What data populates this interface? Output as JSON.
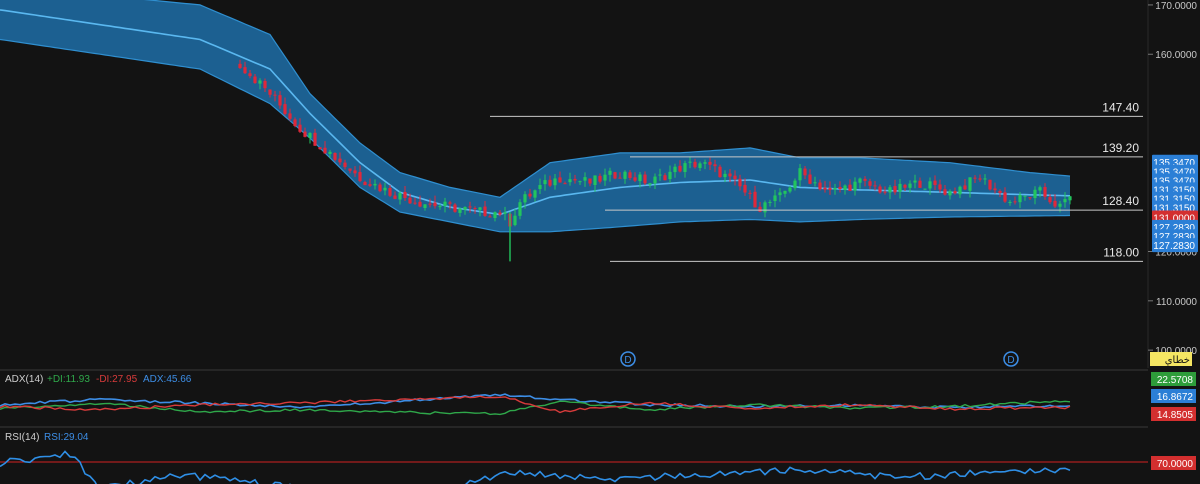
{
  "colors": {
    "background": "#131313",
    "band_fill": "#1e6fa8",
    "band_edge": "#2f8fd0",
    "mid_line": "#5ab8f0",
    "candle_up": "#22c55e",
    "candle_down": "#e0283a",
    "level_line": "#c8c8c8",
    "badge_blue": "#2b7fd6",
    "badge_red": "#d32f2f",
    "badge_green": "#2e9d3a",
    "badge_yellow": "#f5e663",
    "adx_line": "#3d8ee6",
    "plus_di_line": "#2fa84a",
    "minus_di_line": "#d83b3b",
    "rsi_line": "#2f8fe6",
    "rsi_level": "#d02020"
  },
  "price_axis": {
    "ticks": [
      "170.0000",
      "160.0000",
      "120.0000",
      "110.0000",
      "100.0000"
    ],
    "tick_values": [
      170,
      160,
      120,
      110,
      100
    ]
  },
  "level_labels": {
    "l147": "147.40",
    "l139": "139.20",
    "l128": "128.40",
    "l118": "118.00"
  },
  "price_badges": [
    {
      "text": "135.3470",
      "value": 138.2,
      "kind": "blue"
    },
    {
      "text": "135.3470",
      "value": 136.2,
      "kind": "blue"
    },
    {
      "text": "135.3470",
      "value": 134.4,
      "kind": "blue"
    },
    {
      "text": "131.3150",
      "value": 132.6,
      "kind": "blue"
    },
    {
      "text": "131.3150",
      "value": 130.7,
      "kind": "blue"
    },
    {
      "text": "131.3150",
      "value": 128.9,
      "kind": "blue"
    },
    {
      "text": "131.0000",
      "value": 126.9,
      "kind": "red"
    },
    {
      "text": "127.2830",
      "value": 125.0,
      "kind": "blue"
    },
    {
      "text": "127.2830",
      "value": 123.1,
      "kind": "blue"
    },
    {
      "text": "127.2830",
      "value": 121.3,
      "kind": "blue"
    }
  ],
  "event_markers": [
    "D",
    "D"
  ],
  "yellow_badge": "خطاي",
  "adx_panel": {
    "label": "ADX(14)",
    "plus_di": "+DI:11.93",
    "minus_di": "-DI:27.95",
    "adx": "ADX:45.66",
    "badges": [
      "22.5708",
      "16.8672",
      "14.8505"
    ]
  },
  "rsi_panel": {
    "label": "RSI(14)",
    "rsi": "RSI:29.04",
    "badge": "70.0000"
  },
  "chart_data": {
    "type": "candlestick",
    "title": "",
    "xlabel": "",
    "ylabel": "",
    "ylim": [
      98,
      171
    ],
    "indicators": [
      "Bollinger Bands",
      "ADX(14)",
      "RSI(14)"
    ],
    "levels": [
      147.4,
      139.2,
      128.4,
      118.0
    ],
    "price_path": [
      [
        0,
        172
      ],
      [
        6,
        171
      ],
      [
        12,
        168
      ],
      [
        18,
        165
      ],
      [
        24,
        163
      ],
      [
        30,
        163
      ],
      [
        36,
        162
      ],
      [
        42,
        160
      ],
      [
        48,
        158
      ],
      [
        54,
        152
      ],
      [
        60,
        145
      ],
      [
        66,
        140
      ],
      [
        72,
        135
      ],
      [
        78,
        132
      ],
      [
        84,
        130
      ],
      [
        90,
        129
      ],
      [
        96,
        128
      ],
      [
        100,
        128
      ],
      [
        102,
        126
      ],
      [
        104,
        130
      ],
      [
        108,
        133
      ],
      [
        112,
        135
      ],
      [
        118,
        134
      ],
      [
        124,
        136
      ],
      [
        130,
        134
      ],
      [
        136,
        137
      ],
      [
        140,
        138
      ],
      [
        144,
        136
      ],
      [
        148,
        133
      ],
      [
        152,
        129
      ],
      [
        156,
        131
      ],
      [
        160,
        136
      ],
      [
        166,
        132
      ],
      [
        172,
        134
      ],
      [
        178,
        132
      ],
      [
        184,
        134
      ],
      [
        190,
        132
      ],
      [
        196,
        135
      ],
      [
        202,
        130
      ],
      [
        208,
        132
      ],
      [
        212,
        129
      ],
      [
        215,
        132
      ]
    ],
    "bands": {
      "upper": [
        [
          0,
          176
        ],
        [
          20,
          172
        ],
        [
          40,
          170
        ],
        [
          54,
          164
        ],
        [
          62,
          152
        ],
        [
          72,
          142
        ],
        [
          80,
          136
        ],
        [
          90,
          133
        ],
        [
          100,
          131
        ],
        [
          110,
          138
        ],
        [
          124,
          140
        ],
        [
          136,
          140
        ],
        [
          150,
          141
        ],
        [
          160,
          139
        ],
        [
          172,
          139
        ],
        [
          190,
          138
        ],
        [
          206,
          136
        ],
        [
          214,
          135.3
        ]
      ],
      "middle": [
        [
          0,
          169
        ],
        [
          20,
          166
        ],
        [
          40,
          163
        ],
        [
          54,
          157
        ],
        [
          62,
          148
        ],
        [
          72,
          138
        ],
        [
          80,
          132
        ],
        [
          90,
          129
        ],
        [
          100,
          127.5
        ],
        [
          110,
          131
        ],
        [
          124,
          133
        ],
        [
          136,
          134
        ],
        [
          150,
          134.5
        ],
        [
          160,
          133
        ],
        [
          172,
          132.5
        ],
        [
          190,
          132
        ],
        [
          206,
          131.5
        ],
        [
          214,
          131.3
        ]
      ],
      "lower": [
        [
          0,
          163
        ],
        [
          20,
          160
        ],
        [
          40,
          157
        ],
        [
          54,
          150
        ],
        [
          62,
          143
        ],
        [
          72,
          133
        ],
        [
          80,
          128
        ],
        [
          90,
          126
        ],
        [
          100,
          124
        ],
        [
          110,
          124
        ],
        [
          124,
          125
        ],
        [
          136,
          126
        ],
        [
          150,
          126.5
        ],
        [
          160,
          126
        ],
        [
          172,
          126.5
        ],
        [
          190,
          127
        ],
        [
          206,
          127.2
        ],
        [
          214,
          127.3
        ]
      ]
    },
    "adx_series": {
      "x_count": 215,
      "adx": [
        [
          0,
          18
        ],
        [
          20,
          24
        ],
        [
          40,
          20
        ],
        [
          60,
          15
        ],
        [
          80,
          22
        ],
        [
          100,
          30
        ],
        [
          112,
          24
        ],
        [
          130,
          18
        ],
        [
          150,
          16
        ],
        [
          170,
          17
        ],
        [
          190,
          15
        ],
        [
          214,
          16.9
        ]
      ],
      "plus_di": [
        [
          0,
          14
        ],
        [
          20,
          20
        ],
        [
          40,
          10
        ],
        [
          60,
          12
        ],
        [
          80,
          9
        ],
        [
          100,
          7
        ],
        [
          112,
          22
        ],
        [
          130,
          12
        ],
        [
          150,
          18
        ],
        [
          170,
          14
        ],
        [
          190,
          16
        ],
        [
          214,
          22.6
        ]
      ],
      "minus_di": [
        [
          0,
          16
        ],
        [
          20,
          12
        ],
        [
          40,
          18
        ],
        [
          60,
          20
        ],
        [
          80,
          24
        ],
        [
          100,
          28
        ],
        [
          112,
          10
        ],
        [
          130,
          20
        ],
        [
          150,
          14
        ],
        [
          170,
          18
        ],
        [
          190,
          13
        ],
        [
          214,
          14.9
        ]
      ]
    },
    "rsi_series": [
      [
        0,
        62
      ],
      [
        8,
        66
      ],
      [
        14,
        70
      ],
      [
        20,
        40
      ],
      [
        36,
        52
      ],
      [
        50,
        45
      ],
      [
        70,
        35
      ],
      [
        90,
        40
      ],
      [
        104,
        55
      ],
      [
        120,
        48
      ],
      [
        140,
        52
      ],
      [
        160,
        56
      ],
      [
        180,
        50
      ],
      [
        200,
        54
      ],
      [
        214,
        56
      ]
    ]
  }
}
